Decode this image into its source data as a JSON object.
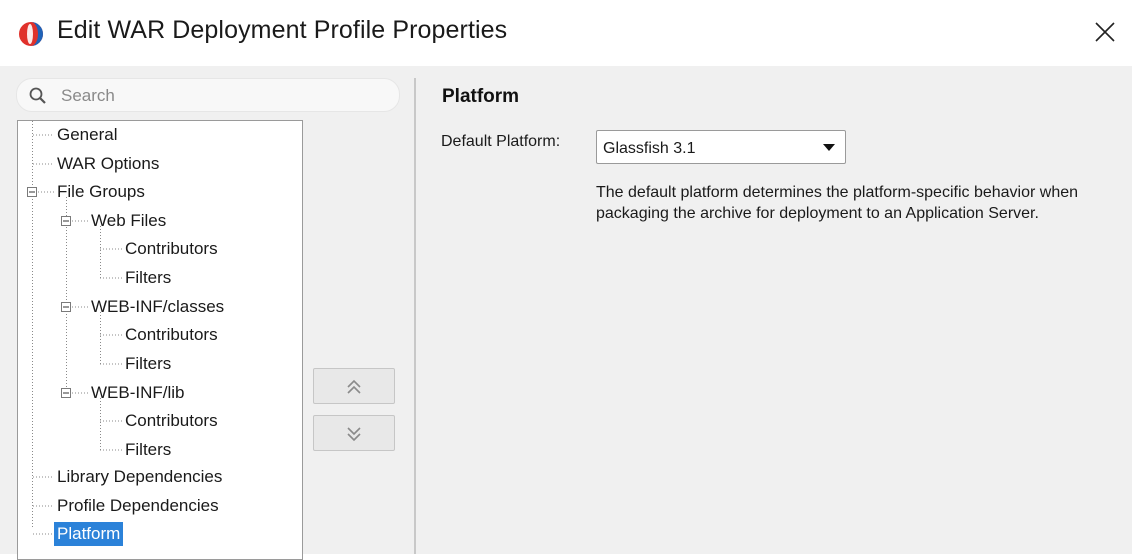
{
  "window": {
    "title": "Edit WAR Deployment Profile Properties",
    "close_label": "×",
    "icon": "app-logo-icon"
  },
  "search": {
    "placeholder": "Search",
    "value": ""
  },
  "tree": {
    "items": [
      {
        "label": "General",
        "level": 0
      },
      {
        "label": "WAR Options",
        "level": 0
      },
      {
        "label": "File Groups",
        "level": 0,
        "expanded": true
      },
      {
        "label": "Web Files",
        "level": 1,
        "expanded": true
      },
      {
        "label": "Contributors",
        "level": 2
      },
      {
        "label": "Filters",
        "level": 2
      },
      {
        "label": "WEB-INF/classes",
        "level": 1,
        "expanded": true
      },
      {
        "label": "Contributors",
        "level": 2
      },
      {
        "label": "Filters",
        "level": 2
      },
      {
        "label": "WEB-INF/lib",
        "level": 1,
        "expanded": true
      },
      {
        "label": "Contributors",
        "level": 2
      },
      {
        "label": "Filters",
        "level": 2
      },
      {
        "label": "Library Dependencies",
        "level": 0
      },
      {
        "label": "Profile Dependencies",
        "level": 0
      },
      {
        "label": "Platform",
        "level": 0,
        "selected": true
      }
    ],
    "move_up_icon": "double-chevron-up-icon",
    "move_down_icon": "double-chevron-down-icon"
  },
  "panel": {
    "title": "Platform",
    "default_platform_label": "Default Platform:",
    "default_platform_value": "Glassfish 3.1",
    "description": "The default platform determines the platform-specific behavior when packaging the archive for deployment to an Application Server."
  },
  "colors": {
    "selection": "#2b82d9",
    "panel_background": "#f0f0f0",
    "logo_red": "#e0312b",
    "logo_blue": "#1f63b8"
  }
}
